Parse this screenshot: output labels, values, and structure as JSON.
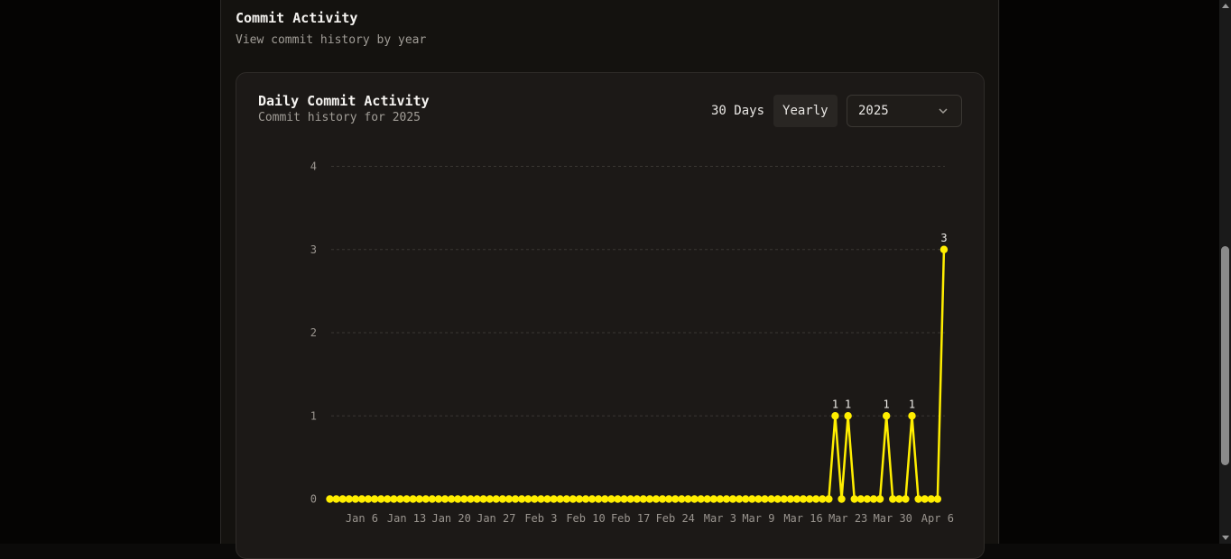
{
  "section": {
    "title": "Commit Activity",
    "subtitle": "View commit history by year"
  },
  "card": {
    "title": "Daily Commit Activity",
    "subtitle": "Commit history for 2025",
    "toggle": [
      {
        "label": "30 Days",
        "active": false
      },
      {
        "label": "Yearly",
        "active": true
      }
    ],
    "year_select": {
      "value": "2025",
      "icon": "chevron-down-icon"
    }
  },
  "colors": {
    "line": "#ffee00",
    "grid": "#3a3733",
    "axis_text": "#9a958f",
    "label_text": "#f0eeea"
  },
  "chart_data": {
    "type": "line",
    "x_start": "Jan 1",
    "x": [
      "Jan 1",
      "Jan 2",
      "Jan 3",
      "Jan 4",
      "Jan 5",
      "Jan 6",
      "Jan 7",
      "Jan 8",
      "Jan 9",
      "Jan 10",
      "Jan 11",
      "Jan 12",
      "Jan 13",
      "Jan 14",
      "Jan 15",
      "Jan 16",
      "Jan 17",
      "Jan 18",
      "Jan 19",
      "Jan 20",
      "Jan 21",
      "Jan 22",
      "Jan 23",
      "Jan 24",
      "Jan 25",
      "Jan 26",
      "Jan 27",
      "Jan 28",
      "Jan 29",
      "Jan 30",
      "Jan 31",
      "Feb 1",
      "Feb 2",
      "Feb 3",
      "Feb 4",
      "Feb 5",
      "Feb 6",
      "Feb 7",
      "Feb 8",
      "Feb 9",
      "Feb 10",
      "Feb 11",
      "Feb 12",
      "Feb 13",
      "Feb 14",
      "Feb 15",
      "Feb 16",
      "Feb 17",
      "Feb 18",
      "Feb 19",
      "Feb 20",
      "Feb 21",
      "Feb 22",
      "Feb 23",
      "Feb 24",
      "Feb 25",
      "Feb 26",
      "Feb 27",
      "Feb 28",
      "Mar 1",
      "Mar 2",
      "Mar 3",
      "Mar 4",
      "Mar 5",
      "Mar 6",
      "Mar 7",
      "Mar 8",
      "Mar 9",
      "Mar 10",
      "Mar 11",
      "Mar 12",
      "Mar 13",
      "Mar 14",
      "Mar 15",
      "Mar 16",
      "Mar 17",
      "Mar 18",
      "Mar 19",
      "Mar 20",
      "Mar 21",
      "Mar 22",
      "Mar 23",
      "Mar 24",
      "Mar 25",
      "Mar 26",
      "Mar 27",
      "Mar 28",
      "Mar 29",
      "Mar 30",
      "Mar 31",
      "Apr 1",
      "Apr 2",
      "Apr 3",
      "Apr 4",
      "Apr 5",
      "Apr 6",
      "Apr 7"
    ],
    "values": [
      0,
      0,
      0,
      0,
      0,
      0,
      0,
      0,
      0,
      0,
      0,
      0,
      0,
      0,
      0,
      0,
      0,
      0,
      0,
      0,
      0,
      0,
      0,
      0,
      0,
      0,
      0,
      0,
      0,
      0,
      0,
      0,
      0,
      0,
      0,
      0,
      0,
      0,
      0,
      0,
      0,
      0,
      0,
      0,
      0,
      0,
      0,
      0,
      0,
      0,
      0,
      0,
      0,
      0,
      0,
      0,
      0,
      0,
      0,
      0,
      0,
      0,
      0,
      0,
      0,
      0,
      0,
      0,
      0,
      0,
      0,
      0,
      0,
      0,
      0,
      0,
      0,
      0,
      0,
      1,
      0,
      1,
      0,
      0,
      0,
      0,
      0,
      1,
      0,
      0,
      0,
      1,
      0,
      0,
      0,
      0,
      3
    ],
    "x_ticks": [
      "Jan 6",
      "Jan 13",
      "Jan 20",
      "Jan 27",
      "Feb 3",
      "Feb 10",
      "Feb 17",
      "Feb 24",
      "Mar 3",
      "Mar 9",
      "Mar 16",
      "Mar 23",
      "Mar 30",
      "Apr 6"
    ],
    "y_ticks": [
      0,
      1,
      2,
      3,
      4
    ],
    "ylim": [
      0,
      4
    ],
    "grid": "horizontal dashed",
    "data_labels": "non-zero values"
  }
}
